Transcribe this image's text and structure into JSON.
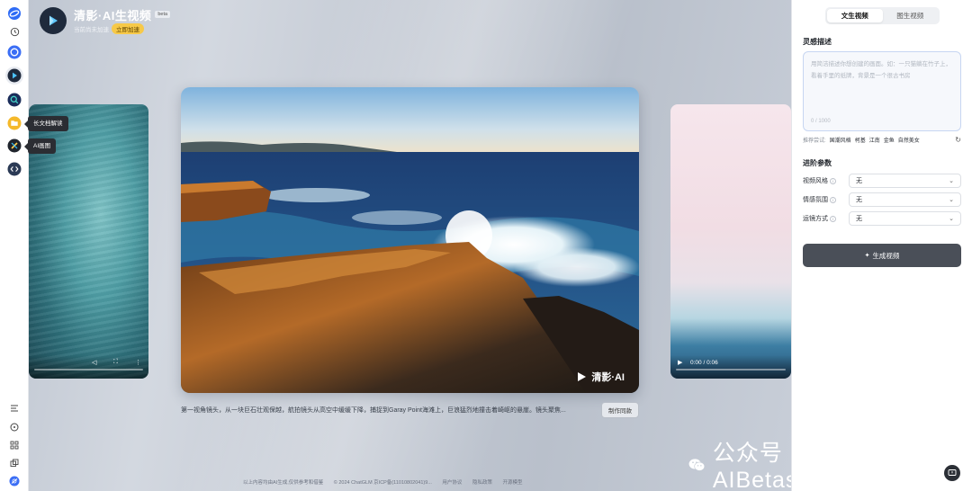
{
  "rail": {
    "items": [
      {
        "name": "logo",
        "icon": "zhipu-logo-icon"
      },
      {
        "name": "history",
        "icon": "clock-icon"
      },
      {
        "name": "chatglm",
        "icon": "chatglm-icon"
      },
      {
        "name": "qingying",
        "icon": "play-icon"
      },
      {
        "name": "search",
        "icon": "search-agent-icon"
      },
      {
        "name": "long-doc",
        "icon": "folder-icon",
        "tooltip": "长文档解读"
      },
      {
        "name": "ai-draw",
        "icon": "ai-draw-icon",
        "tooltip": "AI画图"
      },
      {
        "name": "code",
        "icon": "code-icon"
      },
      {
        "name": "list",
        "icon": "list-icon"
      },
      {
        "name": "explore",
        "icon": "compass-icon"
      },
      {
        "name": "apps",
        "icon": "grid-icon"
      },
      {
        "name": "copy",
        "icon": "copy-icon"
      },
      {
        "name": "avatar",
        "icon": "avatar-icon"
      }
    ]
  },
  "brand": {
    "title": "清影·AI生视频",
    "badge": "beta",
    "subtitle": "当前尚未加速",
    "speed_button": "立即加速"
  },
  "main_video": {
    "watermark": "清影·AI",
    "caption": "第一视角镜头，从一块巨石壮观保越，航拍镜头从高空中缓缓下降，捕捉到Garay Point海滩上，巨浪猛烈地撞击着崎岖的悬崖。镜头聚焦...",
    "same_button": "制作同款"
  },
  "right_side_video": {
    "time": "0:00 / 0:06"
  },
  "footer": {
    "note": "以上内容均由AI生成,仅供参考和借鉴",
    "copyright": "© 2024 ChatGLM 京ICP备(11010802041)9...",
    "agreement": "用户协议",
    "privacy": "隐私政策",
    "open_source": "开源模型"
  },
  "wechat": {
    "text": "公众号 · AIBetas"
  },
  "panel": {
    "tabs": [
      "文生视频",
      "图生视频"
    ],
    "active_tab": 0,
    "prompt_label": "灵感描述",
    "prompt_placeholder": "用简洁描述你想创建的画面。如：一只猫躺在竹子上，看着手里的纸牌，背景是一个很古书房",
    "counter": "0 / 1000",
    "recommend_title": "推荐尝试:",
    "recommend_items": [
      "国潮风格",
      "柯基",
      "江南",
      "金鱼",
      "自然美女"
    ],
    "advanced_label": "进阶参数",
    "params": [
      {
        "label": "视频风格",
        "value": "无"
      },
      {
        "label": "情感氛围",
        "value": "无"
      },
      {
        "label": "运镜方式",
        "value": "无"
      }
    ],
    "generate_button": "生成视频"
  },
  "colors": {
    "accent": "#3b6ef5",
    "dark_button": "#4a4f58",
    "speed_badge": "#f7c948"
  }
}
